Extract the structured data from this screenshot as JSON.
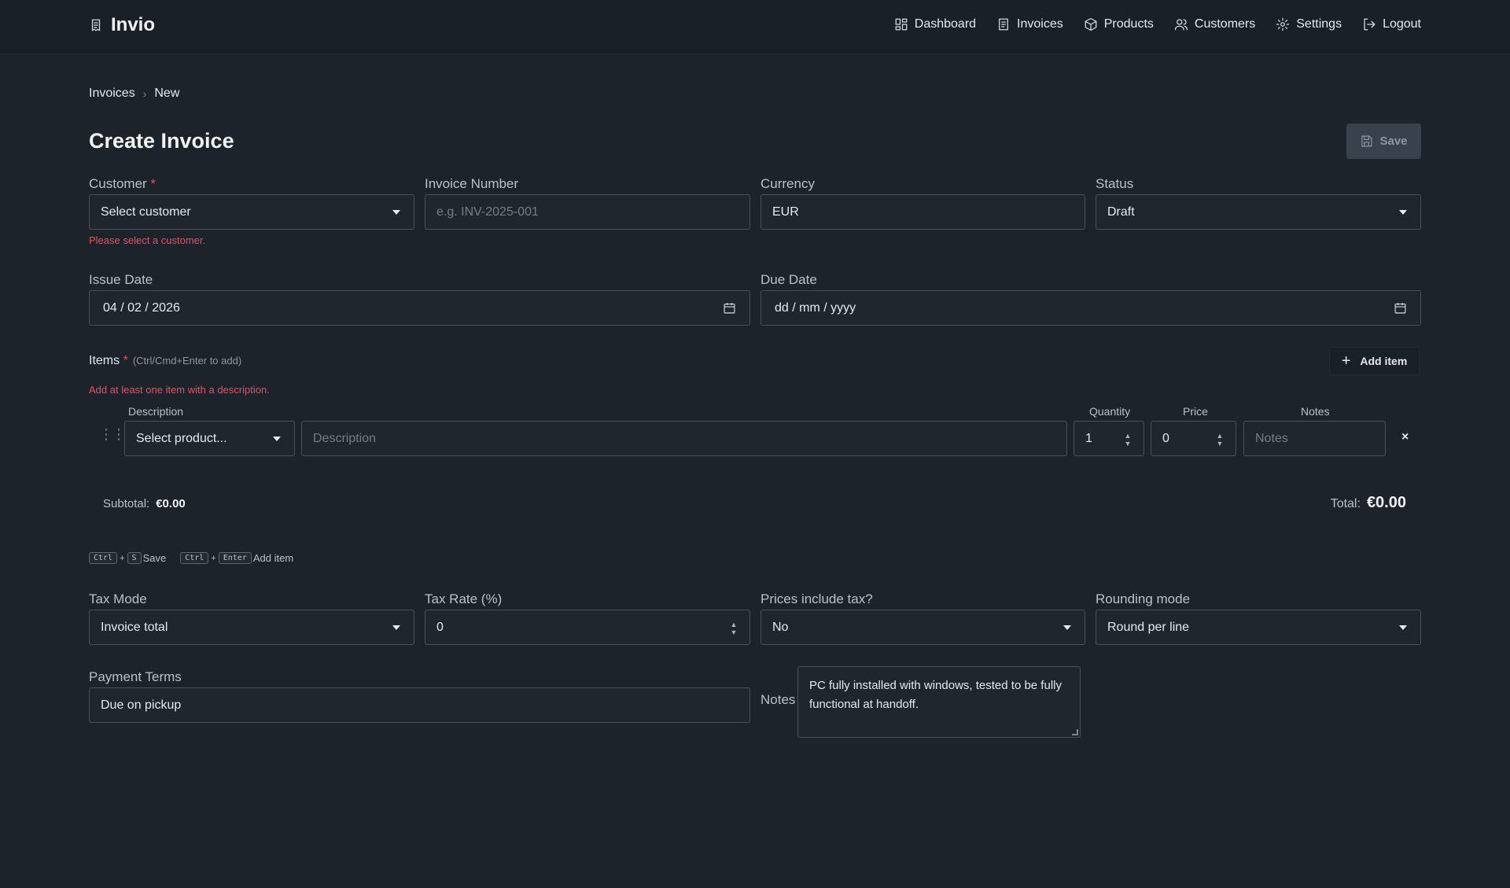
{
  "nav": {
    "brand": "Invio",
    "items": [
      {
        "label": "Dashboard",
        "icon": "dashboard-icon"
      },
      {
        "label": "Invoices",
        "icon": "invoice-icon"
      },
      {
        "label": "Products",
        "icon": "box-icon"
      },
      {
        "label": "Customers",
        "icon": "users-icon"
      },
      {
        "label": "Settings",
        "icon": "gear-icon"
      },
      {
        "label": "Logout",
        "icon": "logout-icon"
      }
    ]
  },
  "breadcrumb": {
    "parent": "Invoices",
    "current": "New"
  },
  "page": {
    "title": "Create Invoice",
    "save_label": "Save"
  },
  "form": {
    "customer": {
      "label": "Customer",
      "required_mark": "*",
      "value": "Select customer",
      "error": "Please select a customer."
    },
    "invoice_number": {
      "label": "Invoice Number",
      "placeholder": "e.g. INV-2025-001"
    },
    "currency": {
      "label": "Currency",
      "value": "EUR"
    },
    "status": {
      "label": "Status",
      "value": "Draft"
    },
    "issue_date": {
      "label": "Issue Date",
      "value": "04 / 02 / 2026"
    },
    "due_date": {
      "label": "Due Date",
      "value": "dd / mm / yyyy"
    }
  },
  "items": {
    "label": "Items",
    "required_mark": "*",
    "hint": "(Ctrl/Cmd+Enter to add)",
    "add_label": "Add item",
    "error": "Add at least one item with a description.",
    "headers": {
      "description": "Description",
      "quantity": "Quantity",
      "price": "Price",
      "notes": "Notes"
    },
    "row": {
      "product": "Select product...",
      "description_placeholder": "Description",
      "quantity": "1",
      "price": "0",
      "notes_placeholder": "Notes",
      "remove": "×"
    }
  },
  "totals": {
    "subtotal_label": "Subtotal:",
    "subtotal_value": "€0.00",
    "total_label": "Total:",
    "total_value": "€0.00"
  },
  "shortcuts": [
    {
      "keys": [
        "Ctrl",
        "S"
      ],
      "label": "Save"
    },
    {
      "keys": [
        "Ctrl",
        "Enter"
      ],
      "label": "Add item"
    }
  ],
  "tax": {
    "mode": {
      "label": "Tax Mode",
      "value": "Invoice total"
    },
    "rate": {
      "label": "Tax Rate (%)",
      "value": "0"
    },
    "includes": {
      "label": "Prices include tax?",
      "value": "No"
    },
    "rounding": {
      "label": "Rounding mode",
      "value": "Round per line"
    }
  },
  "payment": {
    "label": "Payment Terms",
    "value": "Due on pickup"
  },
  "notes": {
    "label": "Notes",
    "value": "PC fully installed with windows, tested to be fully functional at handoff."
  }
}
